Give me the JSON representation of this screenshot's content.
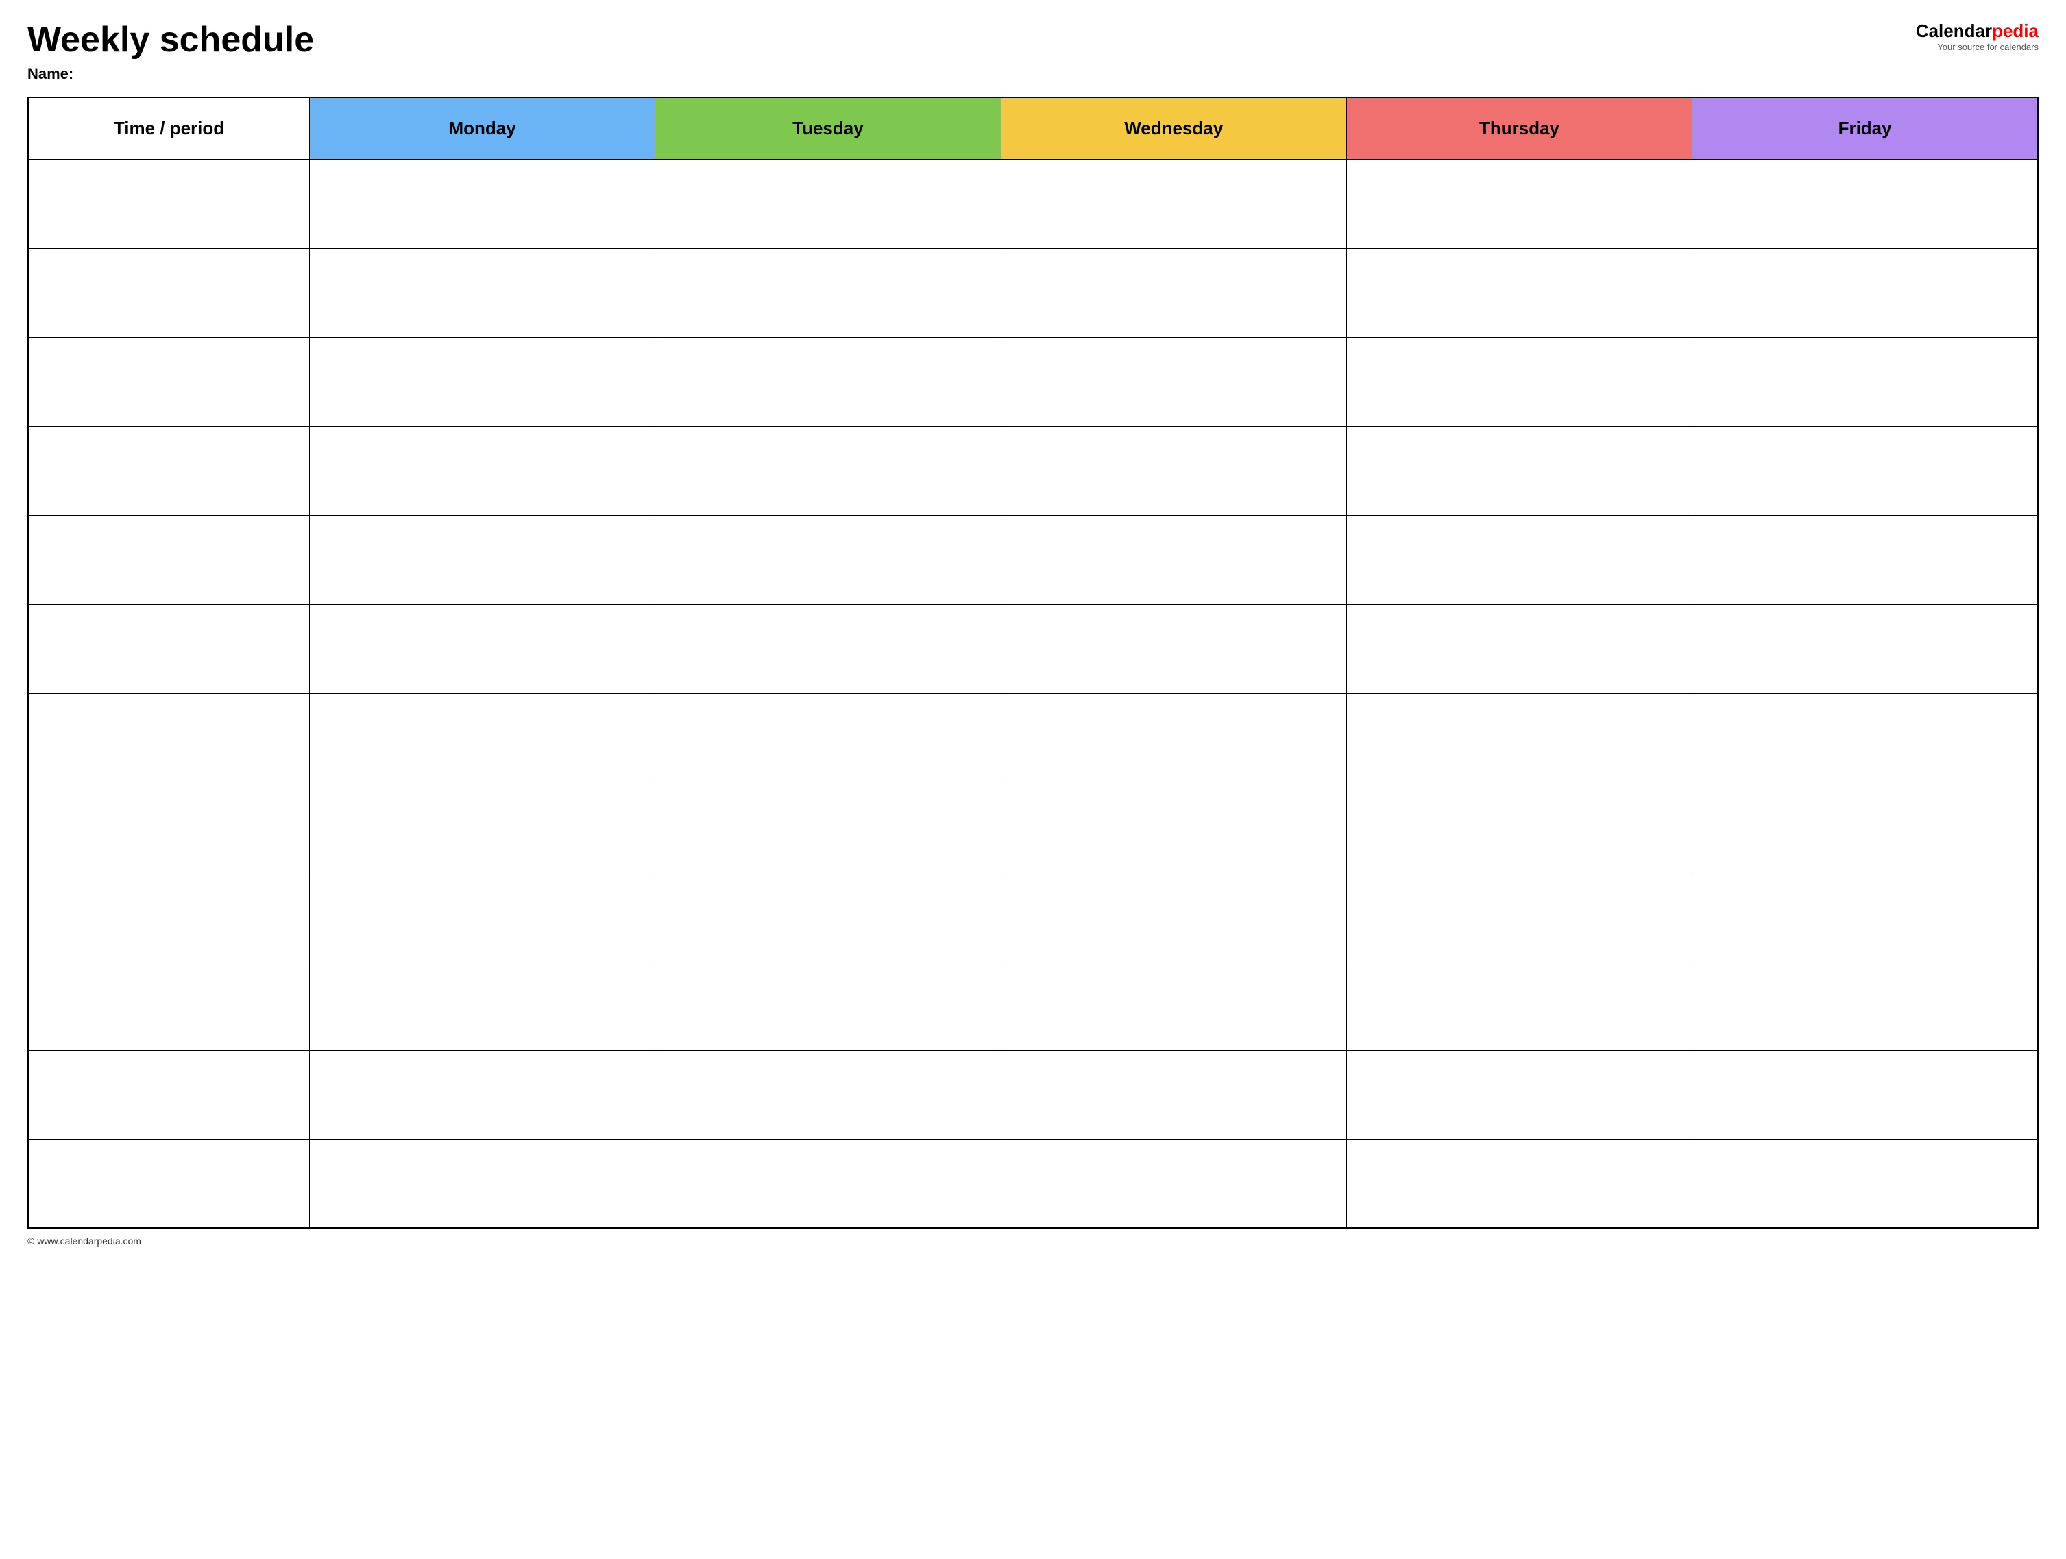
{
  "header": {
    "title": "Weekly schedule",
    "name_label": "Name:",
    "logo_calendar": "Calendar",
    "logo_pedia": "pedia",
    "logo_tagline": "Your source for calendars"
  },
  "table": {
    "columns": [
      {
        "id": "time",
        "label": "Time / period",
        "color": "#ffffff"
      },
      {
        "id": "monday",
        "label": "Monday",
        "color": "#6ab4f5"
      },
      {
        "id": "tuesday",
        "label": "Tuesday",
        "color": "#7ec850"
      },
      {
        "id": "wednesday",
        "label": "Wednesday",
        "color": "#f5c842"
      },
      {
        "id": "thursday",
        "label": "Thursday",
        "color": "#f07070"
      },
      {
        "id": "friday",
        "label": "Friday",
        "color": "#b088f0"
      }
    ],
    "rows": 12
  },
  "footer": {
    "copyright": "© www.calendarpedia.com"
  }
}
